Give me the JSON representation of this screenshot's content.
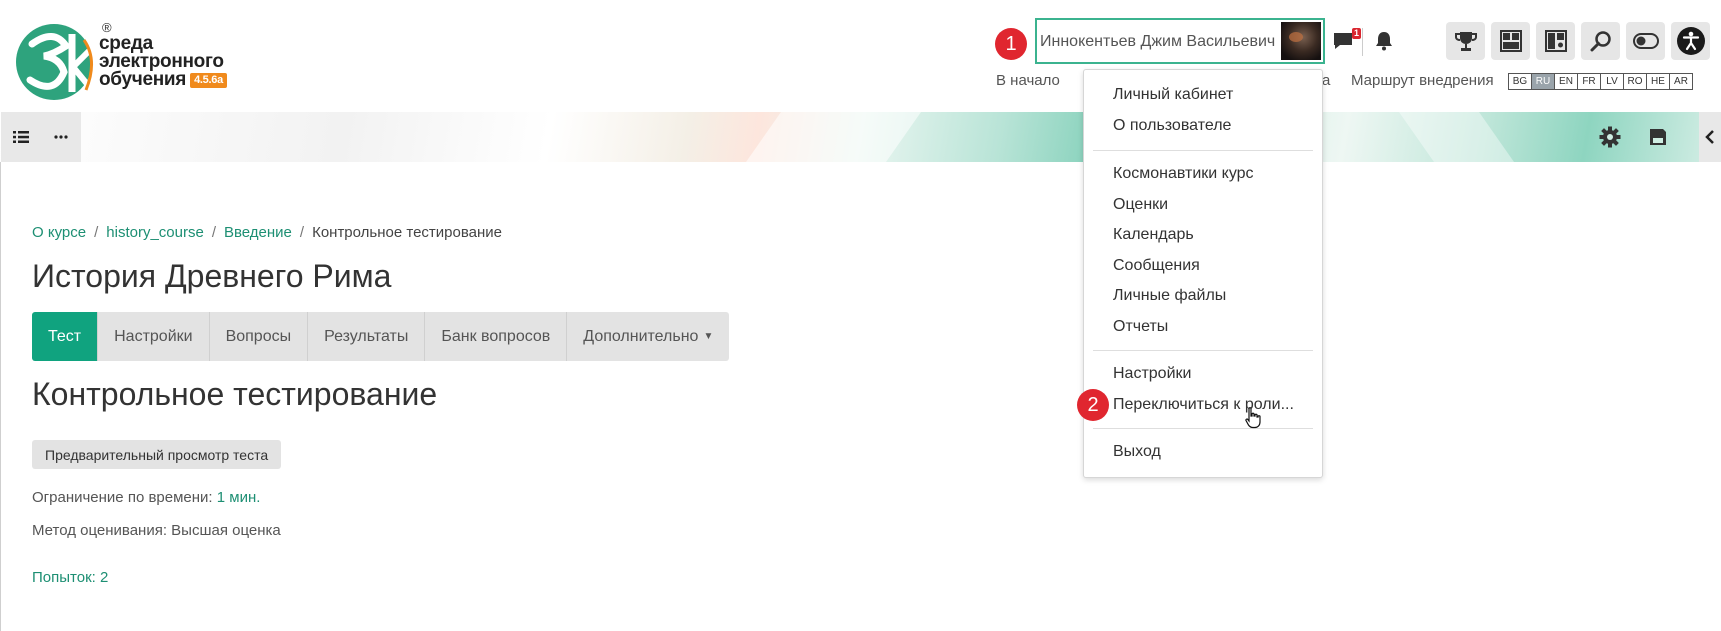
{
  "header": {
    "logo": {
      "lines": [
        "среда",
        "электронного",
        "обучения"
      ],
      "version": "4.5.6a",
      "registered": "®",
      "mark_text": "3k"
    },
    "user": {
      "name": "Иннокентьев Джим Васильевич",
      "messages_count": "1"
    },
    "badges": {
      "first": "1",
      "second": "2"
    },
    "nav": {
      "home": "В начало",
      "route": "Маршрут внедрения",
      "hidden_partial": "а"
    },
    "toolbar_icons": [
      "trophy-icon",
      "dashboard-icon",
      "layout-icon",
      "search-icon",
      "toggle-icon",
      "accessibility-icon"
    ],
    "languages": [
      "BG",
      "RU",
      "EN",
      "FR",
      "LV",
      "RO",
      "HE",
      "AR"
    ],
    "active_language": "RU"
  },
  "breadcrumb": {
    "items": [
      "О курсе",
      "history_course",
      "Введение"
    ],
    "current": "Контрольное тестирование"
  },
  "course": {
    "title": "История Древнего Рима"
  },
  "tabs": [
    {
      "label": "Тест",
      "active": true
    },
    {
      "label": "Настройки"
    },
    {
      "label": "Вопросы"
    },
    {
      "label": "Результаты"
    },
    {
      "label": "Банк вопросов"
    },
    {
      "label": "Дополнительно"
    }
  ],
  "quiz": {
    "title": "Контрольное тестирование",
    "preview_button": "Предварительный просмотр теста",
    "time_limit_label": "Ограничение по времени:",
    "time_limit_value": "1 мин.",
    "grading": "Метод оценивания: Высшая оценка",
    "attempts": "Попыток: 2"
  },
  "user_menu": {
    "items": [
      "Личный кабинет",
      "О пользователе",
      "Космонавтики курс",
      "Оценки",
      "Календарь",
      "Сообщения",
      "Личные файлы",
      "Отчеты",
      "Настройки",
      "Переключиться к роли...",
      "Выход"
    ]
  },
  "colors": {
    "accent": "#10a37f",
    "link": "#1d8f73",
    "badge": "#e0262f",
    "user_box_border": "#3bb38f"
  }
}
